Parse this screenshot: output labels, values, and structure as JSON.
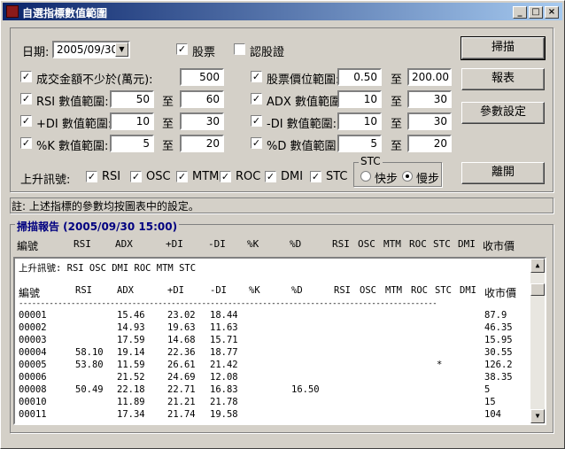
{
  "window": {
    "title": "自選指標數值範圍"
  },
  "form": {
    "date_label": "日期:",
    "date_value": "2005/09/30",
    "stock_label": "股票",
    "warrant_label": "認股證",
    "min_amount_label": "成交金額不少於(萬元):",
    "min_amount": "500",
    "price_range_label": "股票價位範圍:",
    "price_min": "0.50",
    "price_max": "200.00",
    "to": "至",
    "rsi_label": "RSI 數值範圍:",
    "rsi_min": "50",
    "rsi_max": "60",
    "adx_label": "ADX 數值範圍:",
    "adx_min": "10",
    "adx_max": "30",
    "pdi_label": "+DI 數值範圍:",
    "pdi_min": "10",
    "pdi_max": "30",
    "mdi_label": "-DI 數值範圍:",
    "mdi_min": "10",
    "mdi_max": "30",
    "k_label": "%K 數值範圍:",
    "k_min": "5",
    "k_max": "20",
    "d_label": "%D 數值範圍:",
    "d_min": "5",
    "d_max": "20",
    "signal_label": "上升訊號:",
    "signals": [
      "RSI",
      "OSC",
      "MTM",
      "ROC",
      "DMI",
      "STC"
    ],
    "stc_group": "STC",
    "stc_fast": "快步",
    "stc_slow": "慢步"
  },
  "buttons": {
    "scan": "掃描",
    "report": "報表",
    "settings": "參數設定",
    "leave": "離開"
  },
  "note": "註: 上述指標的參數均按圖表中的設定。",
  "report": {
    "title": "掃描報告 (2005/09/30 15:00)",
    "columns": [
      "編號",
      "RSI",
      "ADX",
      "+DI",
      "-DI",
      "%K",
      "%D",
      "RSI",
      "OSC",
      "MTM",
      "ROC",
      "STC",
      "DMI",
      "收市價"
    ],
    "signal_line": "上升訊號:   RSI OSC DMI ROC MTM STC",
    "divider": "------------------------------------------------------------------------------------------------",
    "rows": [
      [
        "00001",
        "",
        "15.46",
        "23.02",
        "18.44",
        "",
        "",
        "",
        "87.9"
      ],
      [
        "00002",
        "",
        "14.93",
        "19.63",
        "11.63",
        "",
        "",
        "",
        "46.35"
      ],
      [
        "00003",
        "",
        "17.59",
        "14.68",
        "15.71",
        "",
        "",
        "",
        "15.95"
      ],
      [
        "00004",
        "58.10",
        "19.14",
        "22.36",
        "18.77",
        "",
        "",
        "",
        "30.55"
      ],
      [
        "00005",
        "53.80",
        "11.59",
        "26.61",
        "21.42",
        "",
        "",
        "*",
        "126.2"
      ],
      [
        "00006",
        "",
        "21.52",
        "24.69",
        "12.08",
        "",
        "",
        "",
        "38.35"
      ],
      [
        "00008",
        "50.49",
        "22.18",
        "22.71",
        "16.83",
        "",
        "16.50",
        "",
        "5"
      ],
      [
        "00010",
        "",
        "11.89",
        "21.21",
        "21.78",
        "",
        "",
        "",
        "15"
      ],
      [
        "00011",
        "",
        "17.34",
        "21.74",
        "19.58",
        "",
        "",
        "",
        "104"
      ]
    ]
  }
}
